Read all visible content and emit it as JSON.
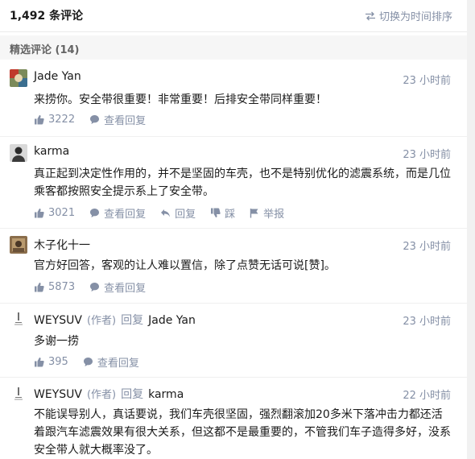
{
  "header": {
    "comment_count": "1,492 条评论",
    "sort_toggle": "切换为时间排序"
  },
  "section": {
    "title": "精选评论 (14)"
  },
  "comments": [
    {
      "author": "Jade Yan",
      "time": "23 小时前",
      "text": "来捞你。安全带很重要！非常重要！后排安全带同样重要！",
      "likes": "3222",
      "view_replies": "查看回复"
    },
    {
      "author": "karma",
      "time": "23 小时前",
      "text": "真正起到决定性作用的，并不是坚固的车壳，也不是特别优化的滤震系统，而是几位乘客都按照安全提示系上了安全带。",
      "likes": "3021",
      "view_replies": "查看回复",
      "reply": "回复",
      "dislike": "踩",
      "report": "举报"
    },
    {
      "author": "木子化十一",
      "time": "23 小时前",
      "text": "官方好回答，客观的让人难以置信，除了点赞无话可说[赞]。",
      "likes": "5873",
      "view_replies": "查看回复"
    },
    {
      "author": "WEYSUV",
      "author_tag": "(作者)",
      "reply_word": "回复",
      "reply_to": "Jade Yan",
      "time": "23 小时前",
      "text": "多谢一捞",
      "likes": "395",
      "view_replies": "查看回复"
    },
    {
      "author": "WEYSUV",
      "author_tag": "(作者)",
      "reply_word": "回复",
      "reply_to": "karma",
      "time": "22 小时前",
      "text": "不能误导别人，真话要说，我们车壳很坚固，强烈翻滚加20多米下落冲击力都还活着跟汽车滤震效果有很大关系，但这都不是最重要的，不管我们车子造得多好，没系安全带人就大概率没了。"
    }
  ],
  "icons": {
    "sort": "swap-arrows-icon",
    "like": "thumbs-up-icon",
    "view_replies": "speech-bubble-icon",
    "reply": "reply-arrow-icon",
    "dislike": "thumbs-down-icon",
    "report": "flag-icon"
  },
  "colors": {
    "meta_gray": "#8590a6",
    "section_bg": "#f6f6f6",
    "text": "#1a1a1a"
  }
}
